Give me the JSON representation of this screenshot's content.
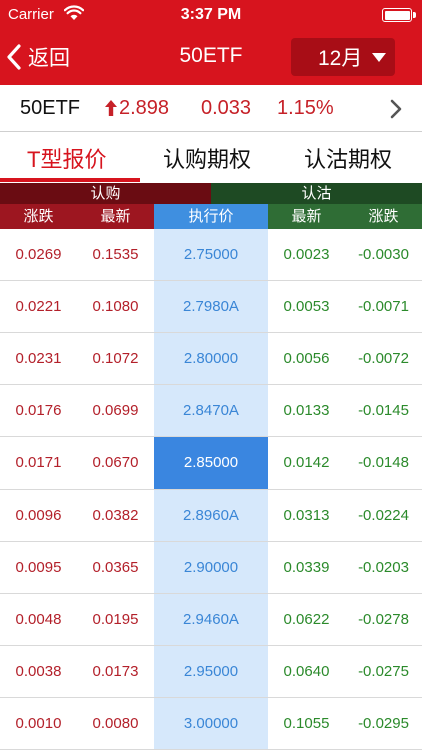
{
  "status_bar": {
    "carrier": "Carrier",
    "time": "3:37 PM"
  },
  "nav": {
    "back_label": "返回",
    "title": "50ETF",
    "month_label": "12月"
  },
  "quote": {
    "symbol": "50ETF",
    "price": "2.898",
    "change": "0.033",
    "change_pct": "1.15%"
  },
  "tabs": [
    {
      "label": "T型报价",
      "active": true
    },
    {
      "label": "认购期权",
      "active": false
    },
    {
      "label": "认沽期权",
      "active": false
    }
  ],
  "table_header": {
    "call_group": "认购",
    "put_group": "认沽",
    "columns": [
      "涨跌",
      "最新",
      "执行价",
      "最新",
      "涨跌"
    ]
  },
  "rows": [
    {
      "call_change": "0.0269",
      "call_last": "0.1535",
      "strike": "2.75000",
      "put_last": "0.0023",
      "put_change": "-0.0030"
    },
    {
      "call_change": "0.0221",
      "call_last": "0.1080",
      "strike": "2.7980A",
      "put_last": "0.0053",
      "put_change": "-0.0071"
    },
    {
      "call_change": "0.0231",
      "call_last": "0.1072",
      "strike": "2.80000",
      "put_last": "0.0056",
      "put_change": "-0.0072"
    },
    {
      "call_change": "0.0176",
      "call_last": "0.0699",
      "strike": "2.8470A",
      "put_last": "0.0133",
      "put_change": "-0.0145"
    },
    {
      "call_change": "0.0171",
      "call_last": "0.0670",
      "strike": "2.85000",
      "put_last": "0.0142",
      "put_change": "-0.0148"
    },
    {
      "call_change": "0.0096",
      "call_last": "0.0382",
      "strike": "2.8960A",
      "put_last": "0.0313",
      "put_change": "-0.0224"
    },
    {
      "call_change": "0.0095",
      "call_last": "0.0365",
      "strike": "2.90000",
      "put_last": "0.0339",
      "put_change": "-0.0203"
    },
    {
      "call_change": "0.0048",
      "call_last": "0.0195",
      "strike": "2.9460A",
      "put_last": "0.0622",
      "put_change": "-0.0278"
    },
    {
      "call_change": "0.0038",
      "call_last": "0.0173",
      "strike": "2.95000",
      "put_last": "0.0640",
      "put_change": "-0.0275"
    },
    {
      "call_change": "0.0010",
      "call_last": "0.0080",
      "strike": "3.00000",
      "put_last": "0.1055",
      "put_change": "-0.0295"
    }
  ],
  "colors": {
    "brand_red": "#d7141e",
    "call_header": "#9d1620",
    "put_header": "#2f6d35",
    "strike_header": "#3f8fe0",
    "atm_highlight": "#3a86e0",
    "strike_column": "#d6e8fb"
  },
  "icons": {
    "wifi": "wifi-icon",
    "battery": "battery-icon",
    "back": "chevron-left-icon",
    "month_caret": "caret-down-icon",
    "price_up": "arrow-up-icon",
    "more": "chevron-right-icon"
  }
}
